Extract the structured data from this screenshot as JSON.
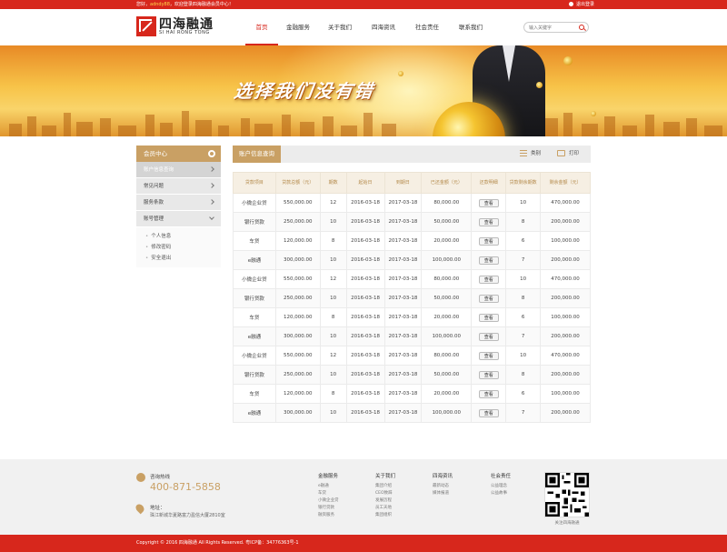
{
  "topbar": {
    "greeting_prefix": "您好，",
    "username": "adndy88",
    "greeting_suffix": "，欢迎登录四海融通会员中心！",
    "exit_label": "退出登录"
  },
  "header": {
    "logo_cn": "四海融通",
    "logo_en": "SI HAI RONG TONG",
    "nav": [
      {
        "label": "首页",
        "active": true
      },
      {
        "label": "金融服务"
      },
      {
        "label": "关于我们"
      },
      {
        "label": "四海资讯"
      },
      {
        "label": "社会责任"
      },
      {
        "label": "联系我们"
      }
    ],
    "search_placeholder": "输入关键字"
  },
  "banner": {
    "slogan": "选择我们没有错"
  },
  "sidebar": {
    "title": "会员中心",
    "items": [
      {
        "label": "账户信息查询",
        "active": true
      },
      {
        "label": "常见问题"
      },
      {
        "label": "服务条款"
      },
      {
        "label": "账号管理",
        "expanded": true
      }
    ],
    "sub_items": [
      "个人信息",
      "修改密码",
      "安全退出"
    ]
  },
  "main": {
    "tab": "账户信息查询",
    "tools": {
      "category": "类别",
      "print": "打印"
    },
    "columns": [
      "贷款项目",
      "贷款总额（元）",
      "期数",
      "起始日",
      "到期日",
      "已还金额（元）",
      "还款明细",
      "贷款剩余期数",
      "剩余金额（元）"
    ],
    "view_label": "查看",
    "rows": [
      [
        "小微企业贷",
        "550,000.00",
        "12",
        "2016-03-18",
        "2017-03-18",
        "80,000.00",
        "10",
        "470,000.00"
      ],
      [
        "银行贷款",
        "250,000.00",
        "10",
        "2016-03-18",
        "2017-03-18",
        "50,000.00",
        "8",
        "200,000.00"
      ],
      [
        "车贷",
        "120,000.00",
        "8",
        "2016-03-18",
        "2017-03-18",
        "20,000.00",
        "6",
        "100,000.00"
      ],
      [
        "e融通",
        "300,000.00",
        "10",
        "2016-03-18",
        "2017-03-18",
        "100,000.00",
        "7",
        "200,000.00"
      ],
      [
        "小微企业贷",
        "550,000.00",
        "12",
        "2016-03-18",
        "2017-03-18",
        "80,000.00",
        "10",
        "470,000.00"
      ],
      [
        "银行贷款",
        "250,000.00",
        "10",
        "2016-03-18",
        "2017-03-18",
        "50,000.00",
        "8",
        "200,000.00"
      ],
      [
        "车贷",
        "120,000.00",
        "8",
        "2016-03-18",
        "2017-03-18",
        "20,000.00",
        "6",
        "100,000.00"
      ],
      [
        "e融通",
        "300,000.00",
        "10",
        "2016-03-18",
        "2017-03-18",
        "100,000.00",
        "7",
        "200,000.00"
      ],
      [
        "小微企业贷",
        "550,000.00",
        "12",
        "2016-03-18",
        "2017-03-18",
        "80,000.00",
        "10",
        "470,000.00"
      ],
      [
        "银行贷款",
        "250,000.00",
        "10",
        "2016-03-18",
        "2017-03-18",
        "50,000.00",
        "8",
        "200,000.00"
      ],
      [
        "车贷",
        "120,000.00",
        "8",
        "2016-03-18",
        "2017-03-18",
        "20,000.00",
        "6",
        "100,000.00"
      ],
      [
        "e融通",
        "300,000.00",
        "10",
        "2016-03-18",
        "2017-03-18",
        "100,000.00",
        "7",
        "200,000.00"
      ]
    ]
  },
  "footer": {
    "hotline_label": "咨询热线",
    "hotline": "400-871-5858",
    "address_label": "地址：",
    "address": "珠江新城华夏路富力盈信大厦2810室",
    "columns": [
      {
        "title": "金融服务",
        "links": [
          "e融通",
          "车贷",
          "小微企业贷",
          "银行贷款",
          "融资服务"
        ]
      },
      {
        "title": "关于我们",
        "links": [
          "集团介绍",
          "CEO致辞",
          "发展历程",
          "员工天地",
          "集团组织"
        ]
      },
      {
        "title": "四海资讯",
        "links": [
          "最新动态",
          "媒体报道"
        ]
      },
      {
        "title": "社会责任",
        "links": [
          "公益理念",
          "公益故事"
        ]
      }
    ],
    "qr_caption": "关注四海融通",
    "copyright": "Copyright © 2016 四海融通 All Rights Reserved.    粤ICP备：34776363号-1"
  },
  "colors": {
    "brand_red": "#d7271c",
    "gold": "#c9a064"
  }
}
